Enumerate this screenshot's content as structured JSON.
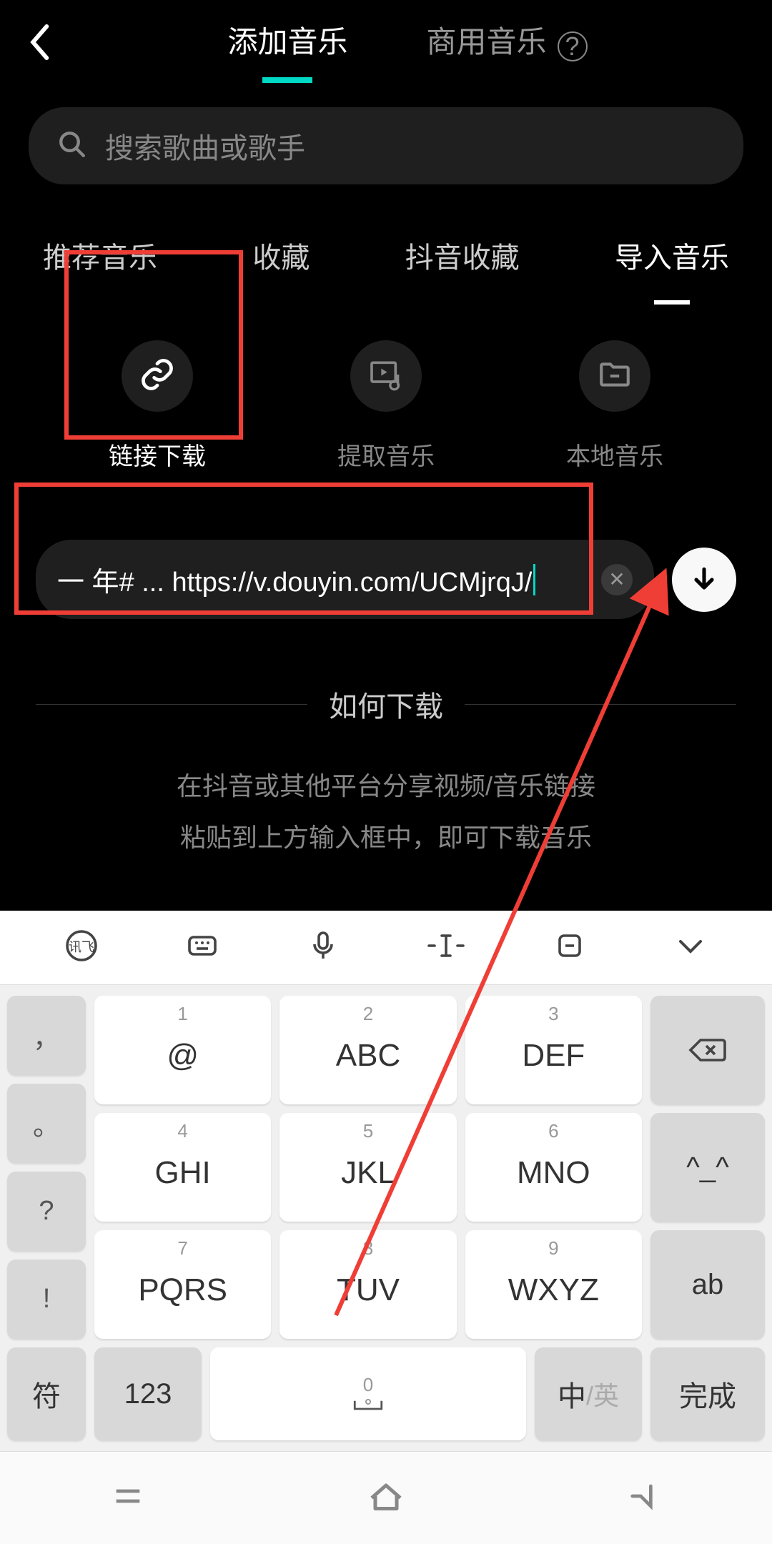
{
  "header": {
    "tab_active": "添加音乐",
    "tab_inactive": "商用音乐"
  },
  "search": {
    "placeholder": "搜索歌曲或歌手"
  },
  "subtabs": {
    "recommend": "推荐音乐",
    "favorites": "收藏",
    "douyin_fav": "抖音收藏",
    "import": "导入音乐"
  },
  "import_options": {
    "link": "链接下载",
    "extract": "提取音乐",
    "local": "本地音乐"
  },
  "url_input": {
    "value": "一 年# ... https://v.douyin.com/UCMjrqJ/"
  },
  "info": {
    "title": "如何下载",
    "line1": "在抖音或其他平台分享视频/音乐链接",
    "line2": "粘贴到上方输入框中，即可下载音乐"
  },
  "keyboard": {
    "keys": [
      {
        "num": "1",
        "main": "@"
      },
      {
        "num": "2",
        "main": "ABC"
      },
      {
        "num": "3",
        "main": "DEF"
      },
      {
        "num": "4",
        "main": "GHI"
      },
      {
        "num": "5",
        "main": "JKL"
      },
      {
        "num": "6",
        "main": "MNO"
      },
      {
        "num": "7",
        "main": "PQRS"
      },
      {
        "num": "8",
        "main": "TUV"
      },
      {
        "num": "9",
        "main": "WXYZ"
      }
    ],
    "puncts": [
      "，",
      "。",
      "?",
      "!"
    ],
    "face": "^_^",
    "ab": "ab",
    "sym": "符",
    "num123": "123",
    "space_num": "0",
    "lang_main": "中",
    "lang_sub": "/英",
    "done": "完成"
  }
}
